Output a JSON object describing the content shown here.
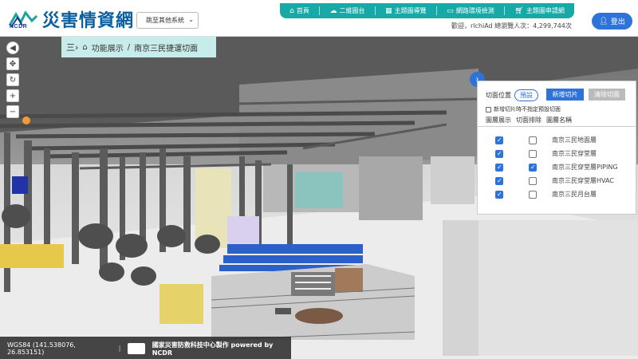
{
  "header": {
    "logo_text": "NCDR",
    "site_title": "災害情資網",
    "system_select": "跳至其他系統"
  },
  "topnav": [
    {
      "icon": "home-icon",
      "label": "首頁"
    },
    {
      "icon": "cloud-icon",
      "label": "二維圖台"
    },
    {
      "icon": "grid-icon",
      "label": "主題圖導覽"
    },
    {
      "icon": "monitor-icon",
      "label": "網路環境檢測"
    },
    {
      "icon": "cart-icon",
      "label": "主題圖申請網"
    }
  ],
  "user": {
    "greeting": "歡迎，rlchiAd",
    "visitors": "總瀏覽人次：4,299,744次",
    "logout": "登出"
  },
  "breadcrumb": {
    "menu_icon": "三›",
    "section": "功能展示",
    "separator": "/",
    "page": "南京三民捷運切面"
  },
  "cut_panel": {
    "position_label": "切面位置",
    "preset": "預設",
    "add_button": "新增切片",
    "clear_button": "清除切面",
    "no_preset_note": "新增切片時不指定預設切面",
    "tabs": [
      "圖層展示",
      "切面排除",
      "圖層名稱"
    ],
    "layers": [
      {
        "name": "南京三民地面層",
        "show": true,
        "exclude": false
      },
      {
        "name": "南京三民穿堂層",
        "show": true,
        "exclude": false
      },
      {
        "name": "南京三民穿堂層PIPING",
        "show": true,
        "exclude": true
      },
      {
        "name": "南京三民穿堂層HVAC",
        "show": true,
        "exclude": false
      },
      {
        "name": "南京三民月台層",
        "show": true,
        "exclude": false
      }
    ]
  },
  "status": {
    "coords": "WGS84 (141.538076, 26.853151)",
    "sep": "|",
    "credit": "國家災害防救科技中心製作 powered by NCDR"
  },
  "colors": {
    "teal": "#17a9a6",
    "blue": "#2e73d9",
    "title": "#0b5fa0"
  }
}
